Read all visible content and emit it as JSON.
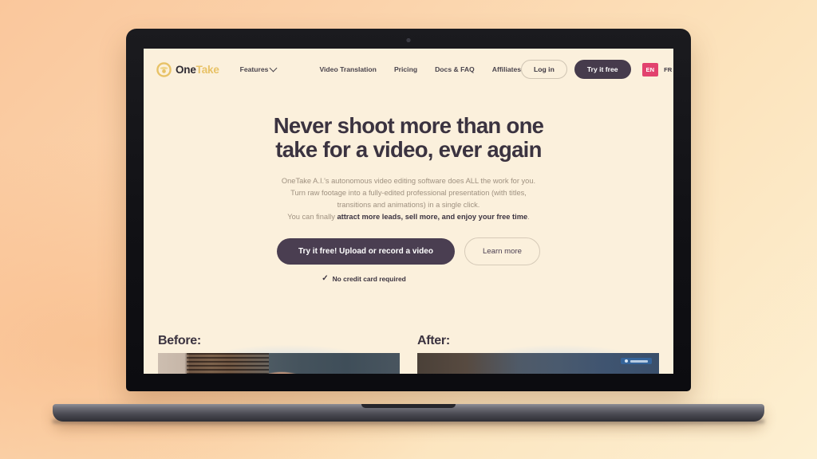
{
  "site": {
    "logo": {
      "icon": "onetake-circle-logo",
      "text_primary": "One",
      "text_accent": "Take"
    },
    "nav": {
      "features": "Features",
      "links": [
        {
          "label": "Video Translation"
        },
        {
          "label": "Pricing"
        },
        {
          "label": "Docs & FAQ"
        },
        {
          "label": "Affiliates"
        }
      ],
      "login_label": "Log in",
      "try_label": "Try it free",
      "lang_active": "EN",
      "lang_alt": "FR"
    },
    "hero": {
      "headline_line1": "Never shoot more than one",
      "headline_line2": "take for a video, ever again",
      "sub_line1": "OneTake A.I.'s autonomous video editing software does ALL the work for you.",
      "sub_line2": "Turn raw footage into a fully-edited professional presentation (with titles,",
      "sub_line3": "transitions and animations) in a single click.",
      "sub_line4_prefix": "You can finally ",
      "sub_line4_bold": "attract more leads, sell more, and enjoy your free time",
      "sub_line4_suffix": ".",
      "cta_primary": "Try it free! Upload or record a video",
      "cta_secondary": "Learn more",
      "no_credit_card": "No credit card required",
      "check_icon": "✓"
    },
    "comparison": {
      "before_label": "Before:",
      "after_label": "After:",
      "before_thumb_alt": "raw-webcam-footage-thumbnail",
      "after_thumb_alt": "edited-video-thumbnail"
    }
  },
  "colors": {
    "background_start": "#FAC79C",
    "background_end": "#FDF0D2",
    "page_background": "#FBF0DC",
    "ink": "#3B3340",
    "muted": "#9F9180",
    "accent_dark": "#4A3E51",
    "accent_gold": "#E8C266",
    "accent_pink": "#E2426E"
  }
}
